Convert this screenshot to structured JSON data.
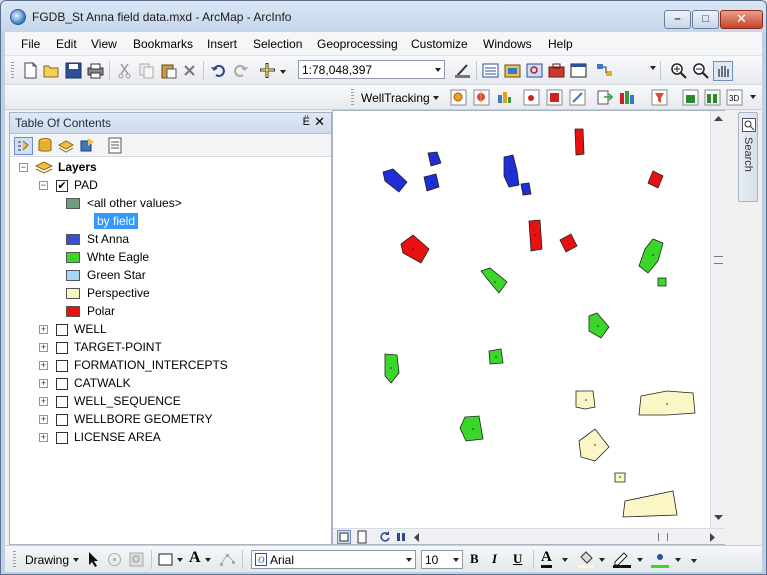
{
  "window": {
    "title": "FGDB_St Anna field data.mxd - ArcMap - ArcInfo",
    "min_label": "–",
    "max_label": "□",
    "close_label": "✕"
  },
  "menu": [
    "File",
    "Edit",
    "View",
    "Bookmarks",
    "Insert",
    "Selection",
    "Geoprocessing",
    "Customize",
    "Windows",
    "Help"
  ],
  "toolbar": {
    "scale": "1:78,048,397",
    "welltracking_label": "WellTracking"
  },
  "toc": {
    "title": "Table Of Contents",
    "pin": "Ё",
    "close": "✕",
    "root": "Layers",
    "pad": {
      "name": "PAD",
      "checked": "✔",
      "classes": [
        {
          "label": "<all other values>",
          "color": "#6e9e7e"
        },
        {
          "label": "by field",
          "color": ""
        },
        {
          "label": "St Anna",
          "color": "#3a4fcf"
        },
        {
          "label": "Whte Eagle",
          "color": "#3ad62a"
        },
        {
          "label": "Green Star",
          "color": "#a6d8f5"
        },
        {
          "label": "Perspective",
          "color": "#fbf6c6"
        },
        {
          "label": "Polar",
          "color": "#e81010"
        }
      ]
    },
    "layers": [
      "WELL",
      "TARGET-POINT",
      "FORMATION_INTERCEPTS",
      "CATWALK",
      "WELL_SEQUENCE",
      "WELLBORE GEOMETRY",
      "LICENSE AREA"
    ]
  },
  "search_tab": "Search",
  "drawing": {
    "label": "Drawing",
    "font": "Arial",
    "size": "10",
    "bold": "B",
    "italic": "I",
    "underline": "U",
    "font_color_glyph": "A"
  }
}
